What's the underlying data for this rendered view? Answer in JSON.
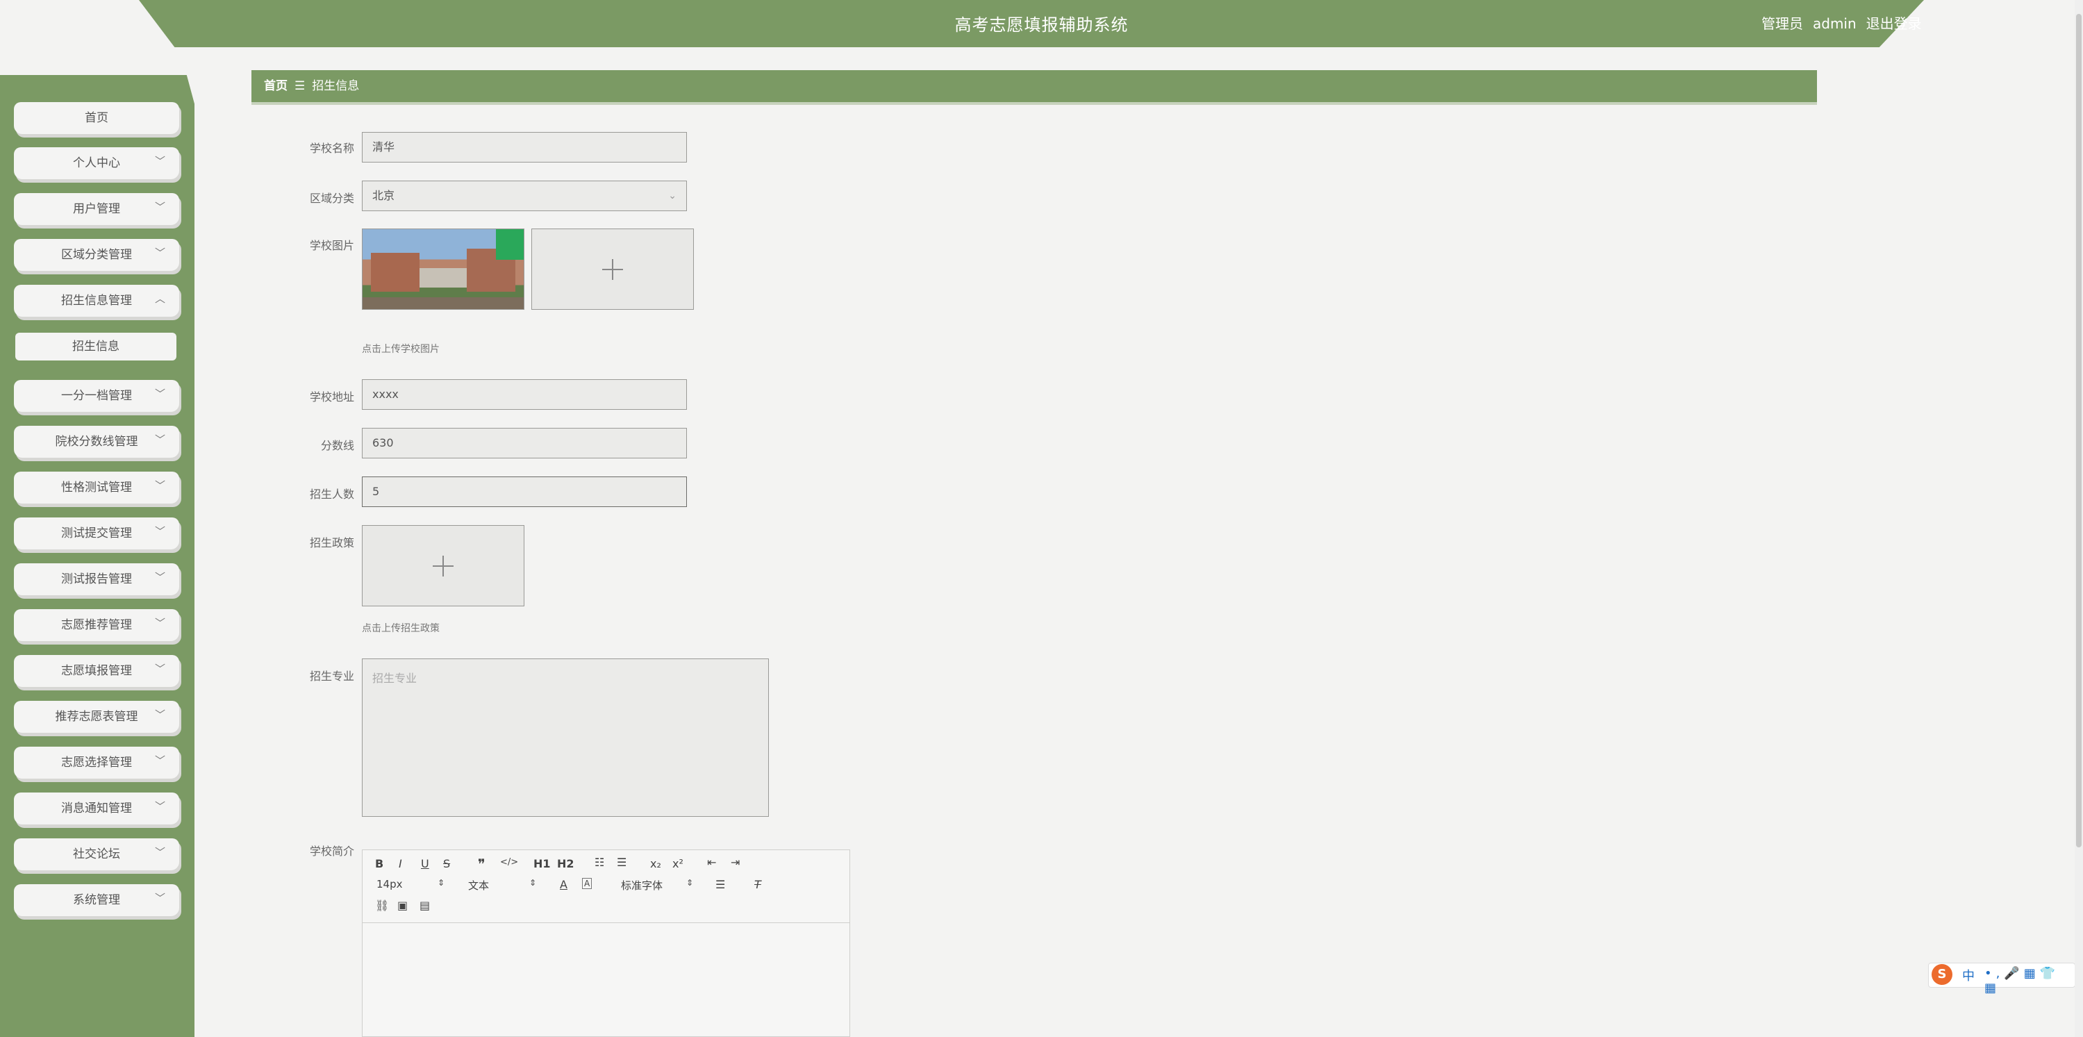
{
  "header": {
    "title": "高考志愿填报辅助系统",
    "role": "管理员",
    "username": "admin",
    "logout": "退出登录"
  },
  "sidebar": {
    "items": [
      {
        "label": "首页",
        "chevron": ""
      },
      {
        "label": "个人中心",
        "chevron": "v"
      },
      {
        "label": "用户管理",
        "chevron": "v"
      },
      {
        "label": "区域分类管理",
        "chevron": "v"
      },
      {
        "label": "招生信息管理",
        "chevron": "^"
      },
      {
        "label": "招生信息",
        "chevron": ""
      },
      {
        "label": "一分一档管理",
        "chevron": "v"
      },
      {
        "label": "院校分数线管理",
        "chevron": "v"
      },
      {
        "label": "性格测试管理",
        "chevron": "v"
      },
      {
        "label": "测试提交管理",
        "chevron": "v"
      },
      {
        "label": "测试报告管理",
        "chevron": "v"
      },
      {
        "label": "志愿推荐管理",
        "chevron": "v"
      },
      {
        "label": "志愿填报管理",
        "chevron": "v"
      },
      {
        "label": "推荐志愿表管理",
        "chevron": "v"
      },
      {
        "label": "志愿选择管理",
        "chevron": "v"
      },
      {
        "label": "消息通知管理",
        "chevron": "v"
      },
      {
        "label": "社交论坛",
        "chevron": "v"
      },
      {
        "label": "系统管理",
        "chevron": "v"
      }
    ]
  },
  "breadcrumb": {
    "home": "首页",
    "sep": "☰",
    "current": "招生信息"
  },
  "form": {
    "school_name": {
      "label": "学校名称",
      "value": "清华"
    },
    "region": {
      "label": "区域分类",
      "value": "北京"
    },
    "school_image": {
      "label": "学校图片",
      "hint": "点击上传学校图片"
    },
    "address": {
      "label": "学校地址",
      "value": "xxxx"
    },
    "score_line": {
      "label": "分数线",
      "value": "630"
    },
    "enroll_count": {
      "label": "招生人数",
      "value": "5"
    },
    "policy": {
      "label": "招生政策",
      "hint": "点击上传招生政策"
    },
    "majors": {
      "label": "招生专业",
      "placeholder": "招生专业"
    },
    "intro": {
      "label": "学校简介"
    }
  },
  "editor": {
    "font_size": "14px",
    "text_style": "文本",
    "font_family": "标准字体",
    "buttons": [
      "B",
      "I",
      "U",
      "S",
      "❞",
      "</>",
      "H1",
      "H2",
      "ol",
      "ul",
      "x₂",
      "x²",
      "outdent",
      "indent"
    ]
  },
  "ime": {
    "mode": "中"
  }
}
